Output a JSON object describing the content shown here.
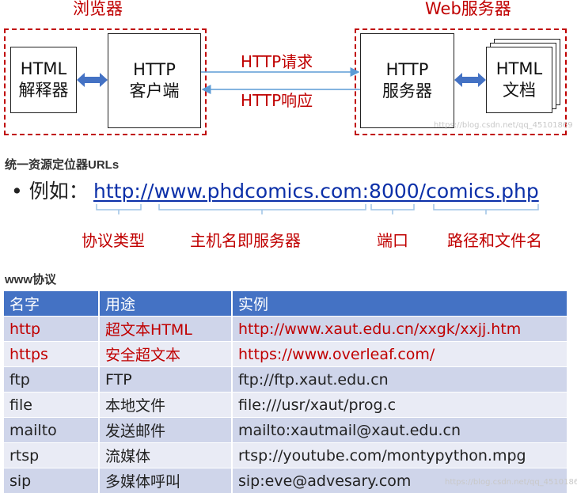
{
  "diagram": {
    "browser_title": "浏览器",
    "server_title": "Web服务器",
    "html_interpreter": [
      "HTML",
      "解释器"
    ],
    "http_client": [
      "HTTP",
      "客户端"
    ],
    "http_server": [
      "HTTP",
      "服务器"
    ],
    "html_doc": [
      "HTML",
      "文档"
    ],
    "request_label": "HTTP请求",
    "response_label": "HTTP响应",
    "watermark": "https://blog.csdn.net/qq_45101869",
    "colors": {
      "accent_red": "#c00000",
      "arrow_blue": "#4472c4",
      "link_blue": "#0b2fa8"
    }
  },
  "url_section": {
    "title": "统一资源定位器URLs",
    "example_prefix": "• 例如：",
    "url": "http://www.phdcomics.com:8000/comics.php",
    "parts": {
      "protocol": "协议类型",
      "host": "主机名即服务器",
      "port": "端口",
      "path": "路径和文件名"
    }
  },
  "www_section": {
    "title": "www协议",
    "table": {
      "headers": [
        "名字",
        "用途",
        "实例"
      ],
      "rows": [
        [
          "http",
          "超文本HTML",
          "http://www.xaut.edu.cn/xxgk/xxjj.htm"
        ],
        [
          "https",
          "安全超文本",
          "https://www.overleaf.com/"
        ],
        [
          "ftp",
          "FTP",
          "ftp://ftp.xaut.edu.cn"
        ],
        [
          "file",
          "本地文件",
          "file:///usr/xaut/prog.c"
        ],
        [
          "mailto",
          "发送邮件",
          "mailto:xautmail@xaut.edu.cn"
        ],
        [
          "rtsp",
          "流媒体",
          "rtsp://youtube.com/montypython.mpg"
        ],
        [
          "sip",
          "多媒体呼叫",
          "sip:eve@advesary.com"
        ]
      ],
      "highlighted_rows": [
        0,
        1
      ],
      "colors": {
        "header_bg": "#4472c4",
        "row_odd": "#cfd5ea",
        "row_even": "#e9ebf5"
      }
    },
    "watermark": "https://blog.csdn.net/qq_45101869"
  }
}
